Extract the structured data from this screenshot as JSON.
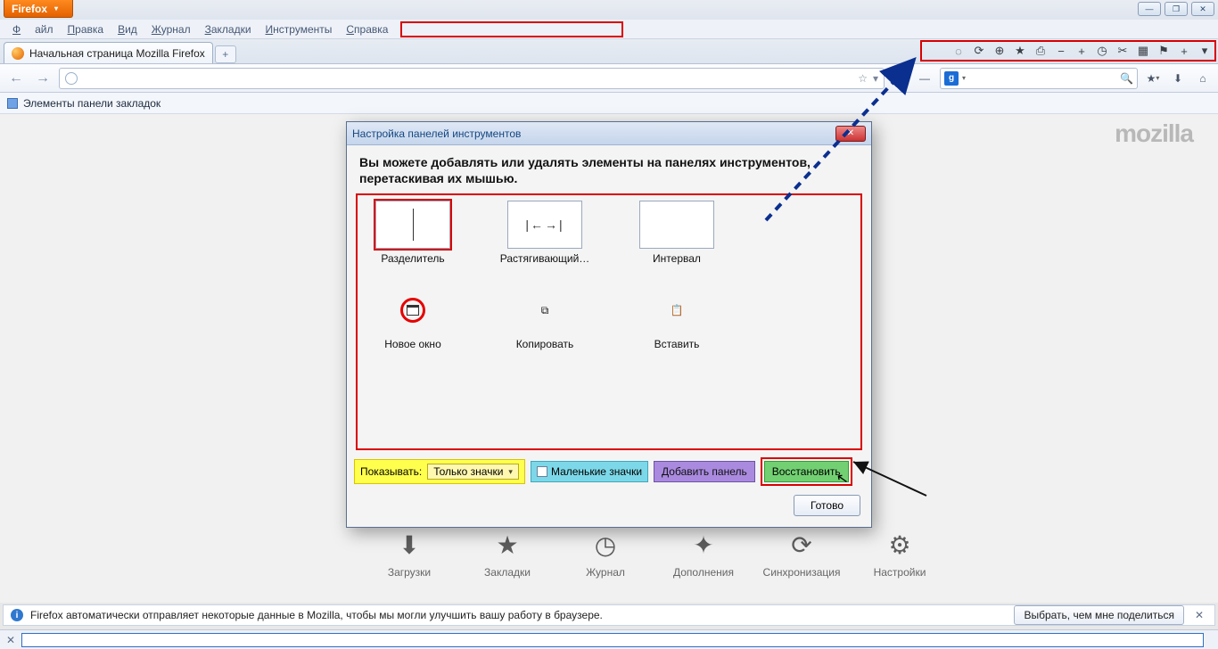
{
  "titlebar": {
    "firefox_label": "Firefox"
  },
  "window_controls": {
    "min": "—",
    "max": "❐",
    "close": "✕"
  },
  "menu": {
    "file": "Файл",
    "edit": "Правка",
    "view": "Вид",
    "history": "Журнал",
    "bookmarks": "Закладки",
    "tools": "Инструменты",
    "help": "Справка"
  },
  "tab": {
    "title": "Начальная страница Mozilla Firefox"
  },
  "toolbar_icons": {
    "spinner": "◌",
    "reload": "⟳",
    "target": "⊕",
    "star_boxed": "★",
    "print": "⎙",
    "minus": "−",
    "plus": "+",
    "clock": "◷",
    "cut": "✂",
    "grid": "▦",
    "rss": "⚑",
    "add": "+",
    "drop": "▾"
  },
  "nav": {
    "back": "←",
    "forward": "→",
    "star": "☆",
    "dropdown": "▾",
    "reload": "⟳",
    "stop": "—"
  },
  "search": {
    "g": "g",
    "magnify": "🔍"
  },
  "rightnav": {
    "bmstar": "★",
    "down": "⬇",
    "home": "⌂"
  },
  "bookmarks_bar": {
    "label": "Элементы панели закладок"
  },
  "brand": "mozilla",
  "quick": {
    "downloads": "Загрузки",
    "bookmarks": "Закладки",
    "history": "Журнал",
    "addons": "Дополнения",
    "sync": "Синхронизация",
    "settings": "Настройки"
  },
  "quick_icons": {
    "downloads": "⬇",
    "bookmarks": "★",
    "history": "◷",
    "addons": "✦",
    "sync": "⟳",
    "settings": "⚙"
  },
  "dialog": {
    "title": "Настройка панелей инструментов",
    "instruction": "Вы можете добавлять или удалять элементы на панелях инструментов, перетаскивая их мышью.",
    "items": {
      "separator": "Разделитель",
      "stretch": "Растягивающий…",
      "interval": "Интервал",
      "newwindow": "Новое окно",
      "copy": "Копировать",
      "paste": "Вставить"
    },
    "icons": {
      "stretch": "|←→|",
      "copy": "⧉",
      "paste": "📋"
    },
    "show_label": "Показывать:",
    "show_value": "Только значки",
    "small_icons": "Маленькие значки",
    "add_panel": "Добавить панель",
    "restore": "Восстановить",
    "done": "Готово"
  },
  "notice": {
    "text": "Firefox автоматически отправляет некоторые данные в Mozilla, чтобы мы могли улучшить вашу работу в браузере.",
    "share_btn": "Выбрать, чем мне поделиться"
  }
}
